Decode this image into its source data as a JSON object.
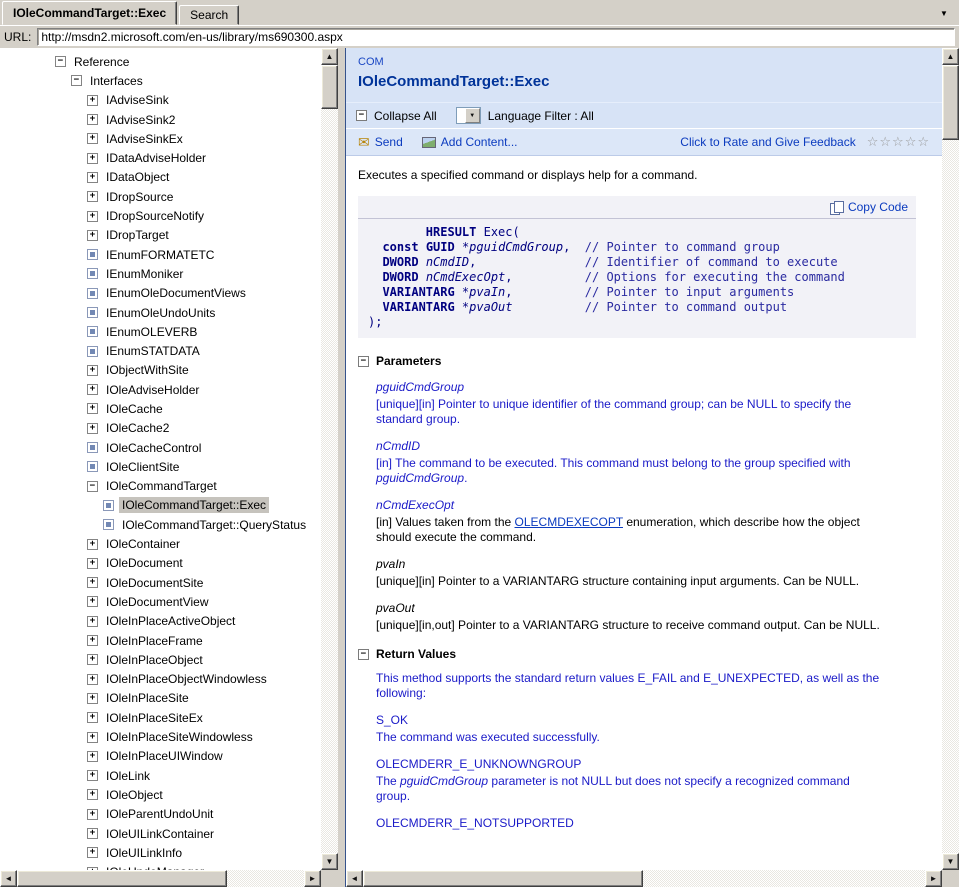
{
  "icons": {
    "up": "▲",
    "down": "▼",
    "left": "◄",
    "right": "►",
    "dropdown": "▼",
    "star": "☆",
    "envelope": "✉",
    "plus": "+",
    "minus": "−"
  },
  "window": {
    "tabs": [
      {
        "label": "IOleCommandTarget::Exec"
      },
      {
        "label": "Search"
      }
    ],
    "url_label": "URL:",
    "url_value": "http://msdn2.microsoft.com/en-us/library/ms690300.aspx"
  },
  "tree": {
    "items": [
      {
        "label": "Reference",
        "icon": "minus",
        "level": 0
      },
      {
        "label": "Interfaces",
        "icon": "minus",
        "level": 1
      },
      {
        "label": "IAdviseSink",
        "icon": "plus",
        "level": 2
      },
      {
        "label": "IAdviseSink2",
        "icon": "plus",
        "level": 2
      },
      {
        "label": "IAdviseSinkEx",
        "icon": "plus",
        "level": 2
      },
      {
        "label": "IDataAdviseHolder",
        "icon": "plus",
        "level": 2
      },
      {
        "label": "IDataObject",
        "icon": "plus",
        "level": 2
      },
      {
        "label": "IDropSource",
        "icon": "plus",
        "level": 2
      },
      {
        "label": "IDropSourceNotify",
        "icon": "plus",
        "level": 2
      },
      {
        "label": "IDropTarget",
        "icon": "plus",
        "level": 2
      },
      {
        "label": "IEnumFORMATETC",
        "icon": "topic",
        "level": 2
      },
      {
        "label": "IEnumMoniker",
        "icon": "topic",
        "level": 2
      },
      {
        "label": "IEnumOleDocumentViews",
        "icon": "topic",
        "level": 2
      },
      {
        "label": "IEnumOleUndoUnits",
        "icon": "topic",
        "level": 2
      },
      {
        "label": "IEnumOLEVERB",
        "icon": "topic",
        "level": 2
      },
      {
        "label": "IEnumSTATDATA",
        "icon": "topic",
        "level": 2
      },
      {
        "label": "IObjectWithSite",
        "icon": "plus",
        "level": 2
      },
      {
        "label": "IOleAdviseHolder",
        "icon": "plus",
        "level": 2
      },
      {
        "label": "IOleCache",
        "icon": "plus",
        "level": 2
      },
      {
        "label": "IOleCache2",
        "icon": "plus",
        "level": 2
      },
      {
        "label": "IOleCacheControl",
        "icon": "topic",
        "level": 2
      },
      {
        "label": "IOleClientSite",
        "icon": "topic",
        "level": 2
      },
      {
        "label": "IOleCommandTarget",
        "icon": "minus",
        "level": 2
      },
      {
        "label": "IOleCommandTarget::Exec",
        "icon": "topic",
        "level": 3,
        "selected": true
      },
      {
        "label": "IOleCommandTarget::QueryStatus",
        "icon": "topic",
        "level": 3
      },
      {
        "label": "IOleContainer",
        "icon": "plus",
        "level": 2
      },
      {
        "label": "IOleDocument",
        "icon": "plus",
        "level": 2
      },
      {
        "label": "IOleDocumentSite",
        "icon": "plus",
        "level": 2
      },
      {
        "label": "IOleDocumentView",
        "icon": "plus",
        "level": 2
      },
      {
        "label": "IOleInPlaceActiveObject",
        "icon": "plus",
        "level": 2
      },
      {
        "label": "IOleInPlaceFrame",
        "icon": "plus",
        "level": 2
      },
      {
        "label": "IOleInPlaceObject",
        "icon": "plus",
        "level": 2
      },
      {
        "label": "IOleInPlaceObjectWindowless",
        "icon": "plus",
        "level": 2
      },
      {
        "label": "IOleInPlaceSite",
        "icon": "plus",
        "level": 2
      },
      {
        "label": "IOleInPlaceSiteEx",
        "icon": "plus",
        "level": 2
      },
      {
        "label": "IOleInPlaceSiteWindowless",
        "icon": "plus",
        "level": 2
      },
      {
        "label": "IOleInPlaceUIWindow",
        "icon": "plus",
        "level": 2
      },
      {
        "label": "IOleLink",
        "icon": "plus",
        "level": 2
      },
      {
        "label": "IOleObject",
        "icon": "plus",
        "level": 2
      },
      {
        "label": "IOleParentUndoUnit",
        "icon": "plus",
        "level": 2
      },
      {
        "label": "IOleUILinkContainer",
        "icon": "plus",
        "level": 2
      },
      {
        "label": "IOleUILinkInfo",
        "icon": "plus",
        "level": 2
      },
      {
        "label": "IOleUndoManager",
        "icon": "plus",
        "level": 2
      }
    ]
  },
  "content": {
    "category": "COM",
    "title": "IOleCommandTarget::Exec",
    "toolbar": {
      "collapse_all": "Collapse All",
      "language_filter": "Language Filter : All"
    },
    "actions": {
      "send": "Send",
      "add_content": "Add Content...",
      "rate": "Click to Rate and Give Feedback",
      "star_count": 5
    },
    "summary": "Executes a specified command or displays help for a command.",
    "code": {
      "copy_label": "Copy Code",
      "lines": [
        [
          {
            "t": "        ",
            "s": "p"
          },
          {
            "t": "HRESULT",
            "s": "k"
          },
          {
            "t": " Exec(",
            "s": "p"
          }
        ],
        [
          {
            "t": "  ",
            "s": "p"
          },
          {
            "t": "const",
            "s": "k"
          },
          {
            "t": " ",
            "s": "p"
          },
          {
            "t": "GUID",
            "s": "k"
          },
          {
            "t": " *",
            "s": "p"
          },
          {
            "t": "pguidCmdGroup",
            "s": "i"
          },
          {
            "t": ",  ",
            "s": "p"
          },
          {
            "t": "// Pointer to command group",
            "s": "c"
          }
        ],
        [
          {
            "t": "  ",
            "s": "p"
          },
          {
            "t": "DWORD",
            "s": "k"
          },
          {
            "t": " ",
            "s": "p"
          },
          {
            "t": "nCmdID",
            "s": "i"
          },
          {
            "t": ",               ",
            "s": "p"
          },
          {
            "t": "// Identifier of command to execute",
            "s": "c"
          }
        ],
        [
          {
            "t": "  ",
            "s": "p"
          },
          {
            "t": "DWORD",
            "s": "k"
          },
          {
            "t": " ",
            "s": "p"
          },
          {
            "t": "nCmdExecOpt",
            "s": "i"
          },
          {
            "t": ",          ",
            "s": "p"
          },
          {
            "t": "// Options for executing the command",
            "s": "c"
          }
        ],
        [
          {
            "t": "  ",
            "s": "p"
          },
          {
            "t": "VARIANTARG",
            "s": "k"
          },
          {
            "t": " *",
            "s": "p"
          },
          {
            "t": "pvaIn",
            "s": "i"
          },
          {
            "t": ",          ",
            "s": "p"
          },
          {
            "t": "// Pointer to input arguments",
            "s": "c"
          }
        ],
        [
          {
            "t": "  ",
            "s": "p"
          },
          {
            "t": "VARIANTARG",
            "s": "k"
          },
          {
            "t": " *",
            "s": "p"
          },
          {
            "t": "pvaOut",
            "s": "i"
          },
          {
            "t": "          ",
            "s": "p"
          },
          {
            "t": "// Pointer to command output",
            "s": "c"
          }
        ],
        [
          {
            "t": ");",
            "s": "p"
          }
        ]
      ]
    },
    "sections": [
      {
        "heading": "Parameters",
        "entries": [
          {
            "term": "pguidCmdGroup",
            "style": "blue-italic",
            "desc": [
              {
                "t": "[unique][in] Pointer to unique identifier of the command group; can be NULL to specify the standard group.",
                "s": "blue"
              }
            ]
          },
          {
            "term": "nCmdID",
            "style": "blue-italic",
            "desc": [
              {
                "t": "[in] The command to be executed. This command must belong to the group specified with ",
                "s": "blue"
              },
              {
                "t": "pguidCmdGroup",
                "s": "blue-italic"
              },
              {
                "t": ".",
                "s": "blue"
              }
            ]
          },
          {
            "term": "nCmdExecOpt",
            "style": "blue-italic",
            "desc": [
              {
                "t": "[in] Values taken from the ",
                "s": "black"
              },
              {
                "t": "OLECMDEXECOPT",
                "s": "link"
              },
              {
                "t": " enumeration, which describe how the object should execute the command.",
                "s": "black"
              }
            ]
          },
          {
            "term": "pvaIn",
            "style": "black-italic",
            "desc": [
              {
                "t": "[unique][in] Pointer to a VARIANTARG structure containing input arguments. Can be NULL.",
                "s": "black"
              }
            ]
          },
          {
            "term": "pvaOut",
            "style": "black-italic",
            "desc": [
              {
                "t": "[unique][in,out] Pointer to a VARIANTARG structure to receive command output. Can be NULL.",
                "s": "black"
              }
            ]
          }
        ]
      },
      {
        "heading": "Return Values",
        "paragraphs": [
          [
            {
              "t": "This method supports the standard return values E_FAIL and E_UNEXPECTED, as well as the following:",
              "s": "blue"
            }
          ]
        ],
        "entries": [
          {
            "term": "S_OK",
            "style": "blue",
            "desc": [
              {
                "t": "The command was executed successfully.",
                "s": "blue"
              }
            ]
          },
          {
            "term": "OLECMDERR_E_UNKNOWNGROUP",
            "style": "blue",
            "desc": [
              {
                "t": "The ",
                "s": "blue"
              },
              {
                "t": "pguidCmdGroup",
                "s": "blue-italic"
              },
              {
                "t": " parameter is not NULL but does not specify a recognized command group.",
                "s": "blue"
              }
            ]
          },
          {
            "term": "OLECMDERR_E_NOTSUPPORTED",
            "style": "blue",
            "desc": []
          }
        ]
      }
    ]
  }
}
